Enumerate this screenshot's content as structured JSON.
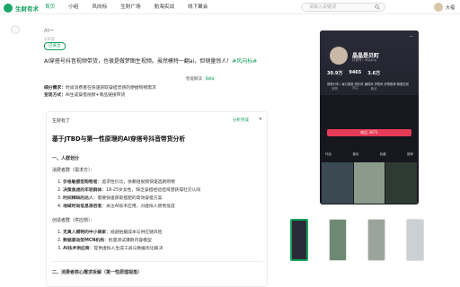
{
  "app": {
    "logo_text": "生财有术",
    "accent": "#16a060"
  },
  "nav": [
    "首页",
    "小组",
    "风向标",
    "生财广场",
    "航海实战",
    "线下聚会"
  ],
  "search": {
    "placeholder": "请输入关键词"
  },
  "user": {
    "name": "大福"
  },
  "post": {
    "author": "川一",
    "date": "2天前",
    "follow_label": "已关注",
    "text_main": "AI穿搭号抖音视频带货，也很是做梦图生视频。虽然模特一翻ai，但销量惊人！",
    "text_hash": "#风向标#",
    "meta_need_label": "细分需求：",
    "meta_need": "时尚消费者在快速获取穿搭灵感的便捷购物需求",
    "meta_mode_label": "变现方式：",
    "meta_mode": "AI生成穿搭视频+商品链接带货",
    "meta_btn": "智能解读",
    "meta_btn_tag": "Beta"
  },
  "card": {
    "header": "生财有丁",
    "share": "分析完成",
    "title": "基于JTBD与第一性原理的AI穿搭号抖音带货分析",
    "s1": "一、人群划分",
    "s1a": "消费者群（需求方）：",
    "s1a_items": [
      {
        "label": "价格敏感型购物者",
        "text": "：追求性价比，依赖短视频快速选款购物"
      },
      {
        "label": "决策焦虑的年轻群体",
        "text": "：18-25岁女性，缺乏穿搭经验但渴望获得社交认同"
      },
      {
        "label": "时间稀缺的达人",
        "text": "：需要快速获取搭配的高效穿搭方案"
      },
      {
        "label": "地域时尚信息滞后者",
        "text": "：关注AI技术应用，对虚拟人感觉低度"
      }
    ],
    "s1b": "创造者群（供应侧）：",
    "s1b_items": [
      {
        "label": "无真人模特的中小商家",
        "text": "：规避拍摄成本与供应链风险"
      },
      {
        "label": "数据驱动型MCN机构",
        "text": "：批量测试爆款内容模型"
      },
      {
        "label": "AI技术供应商",
        "text": "：提供虚拟人生成工具与数据优化解决"
      }
    ],
    "s2": "二、消费者核心需求拆解（第一性原理视角）"
  },
  "phone": {
    "name": "晶晶是贝町",
    "id": "抖音号：Jingjing",
    "stats": [
      {
        "value": "30.9万",
        "label": "获赞"
      },
      {
        "value": "9465",
        "label": "关注"
      },
      {
        "value": "3.6万",
        "label": "粉丝"
      }
    ],
    "bio": "穿搭分享 | 每日更新 简约风 通勤风 学院风 好物推荐 橱窗在线",
    "button": "商品 3671",
    "tabs": [
      "作品",
      "喜欢",
      "收藏",
      "推荐"
    ],
    "grid_colors": [
      "#3b4a52",
      "#8b9a8a",
      "#2e3b33",
      "#5a6f5c",
      "#3d4a44",
      "#2a3a35",
      "#44524a",
      "#6e7d72",
      "#3a463f"
    ]
  },
  "thumbs": [
    "#2b2b38",
    "#6f8a72",
    "#9aa49c",
    "#c9d0d6"
  ]
}
